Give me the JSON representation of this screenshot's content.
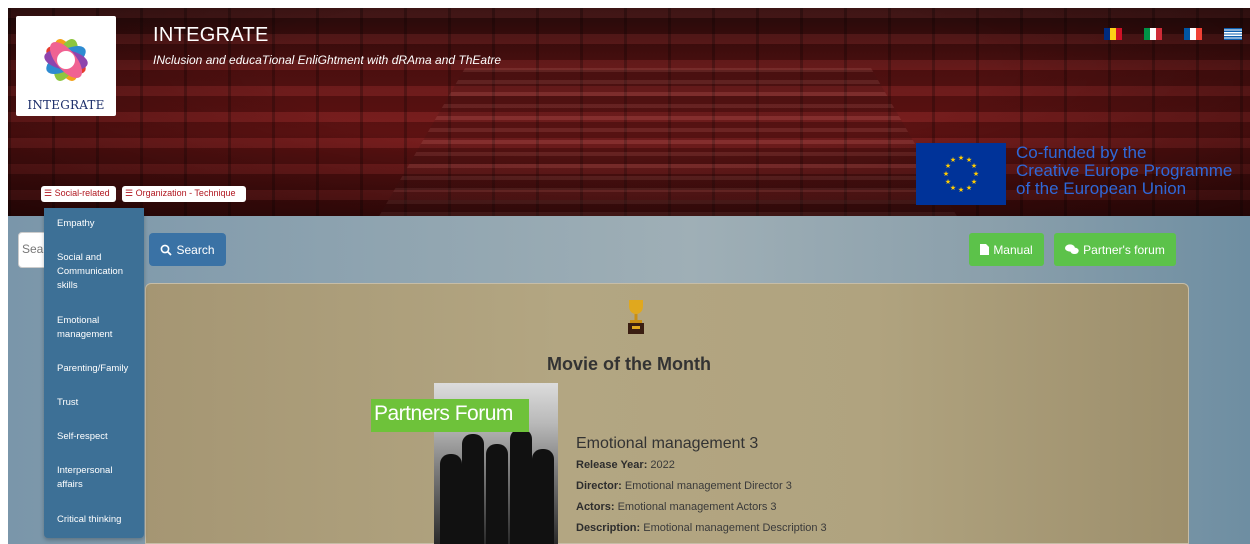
{
  "header": {
    "logo_text": "INTEGRATE",
    "title": "INTEGRATE",
    "subtitle": "INclusion and educaTional EnliGhtment with dRAma and ThEatre",
    "flags": [
      "romania-flag-icon",
      "italy-flag-icon",
      "france-flag-icon",
      "greece-flag-icon"
    ],
    "eu_text_1": "Co-funded by the",
    "eu_text_2": "Creative Europe Programme",
    "eu_text_3": "of the European Union",
    "menu_tags": [
      {
        "label": "☰ Social-related"
      },
      {
        "label": "☰ Organization - Technique"
      }
    ]
  },
  "dropdown": {
    "items": [
      {
        "label": "Empathy"
      },
      {
        "label": "Social and Communication skills"
      },
      {
        "label": "Emotional management"
      },
      {
        "label": "Parenting/Family"
      },
      {
        "label": "Trust"
      },
      {
        "label": "Self-respect"
      },
      {
        "label": "Interpersonal affairs"
      },
      {
        "label": "Critical thinking"
      }
    ]
  },
  "search": {
    "placeholder": "Search",
    "button_label": "Search"
  },
  "actions": {
    "manual_label": "Manual",
    "forum_label": "Partner's forum"
  },
  "movie": {
    "section_title": "Movie of the Month",
    "overlay_label": "Partners Forum",
    "name": "Emotional management 3",
    "release_label": "Release Year:",
    "release_value": "2022",
    "director_label": "Director:",
    "director_value": "Emotional management Director 3",
    "actors_label": "Actors:",
    "actors_value": "Emotional management Actors 3",
    "description_label": "Description:",
    "description_value": "Emotional management Description 3"
  },
  "colors": {
    "primary_blue": "#3a72a5",
    "green": "#5cc24a",
    "dropdown_bg": "#3d7096",
    "tag_text": "#b0161f"
  }
}
